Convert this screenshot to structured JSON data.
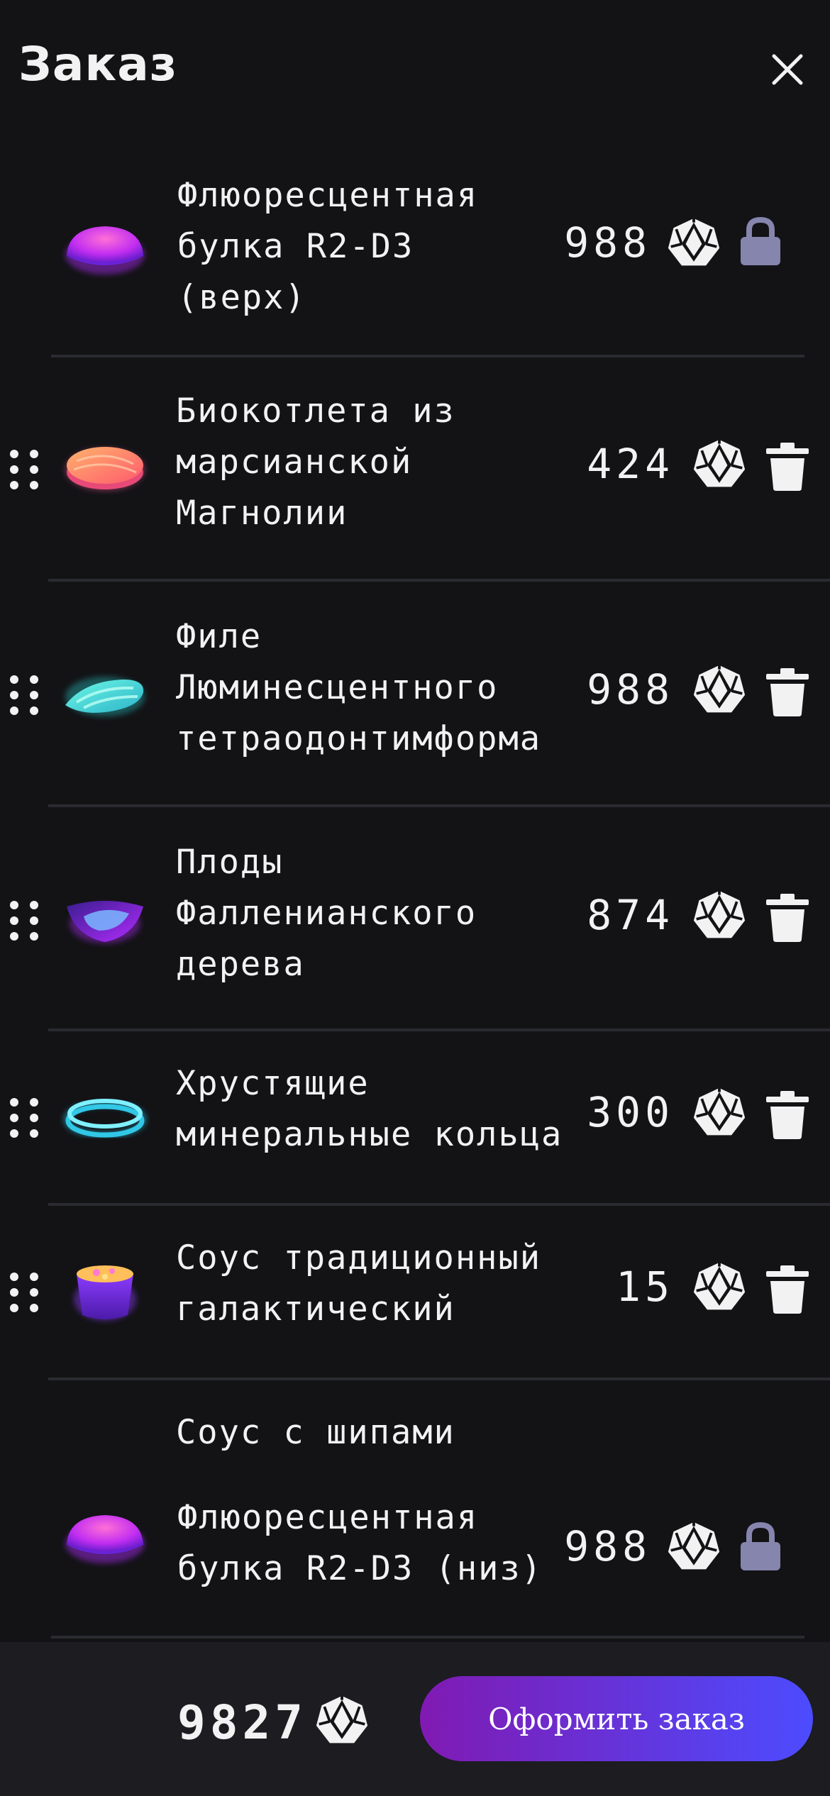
{
  "header": {
    "title": "Заказ"
  },
  "order": {
    "top_bun": {
      "name": "Флюоресцентная\nбулка R2-D3\n(верх)",
      "price": "988"
    },
    "items": [
      {
        "name": "Биокотлета из\nмарсианской\nМагнолии",
        "price": "424"
      },
      {
        "name": "Филе\nЛюминесцентного\nтетраодонтимформа",
        "price": "988"
      },
      {
        "name": "Плоды\nФалленианского\nдерева",
        "price": "874"
      },
      {
        "name": "Хрустящие\nминеральные кольца",
        "price": "300"
      },
      {
        "name": "Соус традиционный\nгалактический",
        "price": "15"
      },
      {
        "name": "Соус с шипами",
        "price": ""
      }
    ],
    "bottom_bun": {
      "name": "Флюоресцентная\nбулка R2-D3 (низ)",
      "price": "988"
    }
  },
  "footer": {
    "total": "9827",
    "order_button": "Оформить заказ"
  },
  "colors": {
    "accent_start": "#801ab2",
    "accent_end": "#4c4cff",
    "lock": "#8585ad"
  },
  "icons": [
    "close-icon",
    "drag-handle-icon",
    "currency-icon",
    "lock-icon",
    "trash-icon"
  ]
}
